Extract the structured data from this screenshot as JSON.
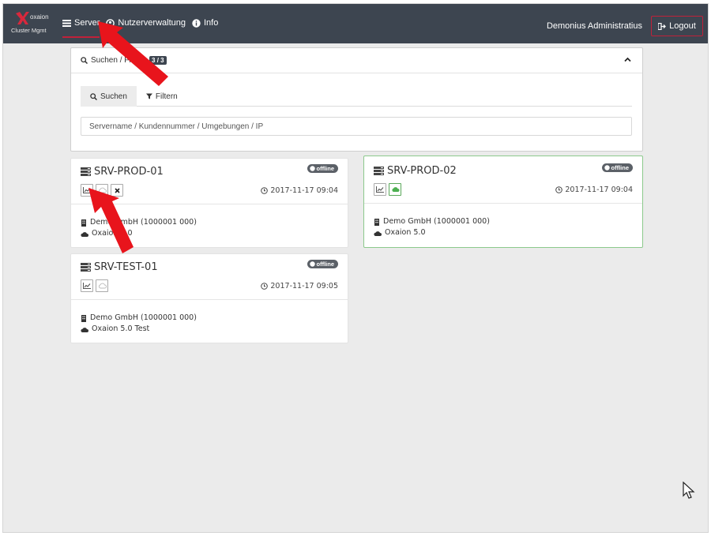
{
  "app": {
    "brand": "oxaion",
    "subtitle": "Cluster Mgmt",
    "accent_color": "#c0213a",
    "navbar_color": "#3d4550"
  },
  "nav": {
    "items": [
      {
        "label": "Server",
        "icon": "server-icon",
        "active": true
      },
      {
        "label": "Nutzerverwaltung",
        "icon": "user-circle-icon",
        "active": false
      },
      {
        "label": "Info",
        "icon": "info-icon",
        "active": false
      }
    ],
    "user_name": "Demonius Administratius",
    "logout_label": "Logout"
  },
  "search": {
    "title": "Suchen / Filtern",
    "count": "3 / 3",
    "tabs": [
      {
        "label": "Suchen",
        "icon": "search-icon",
        "active": true
      },
      {
        "label": "Filtern",
        "icon": "filter-icon",
        "active": false
      }
    ],
    "placeholder": "Servername / Kundennummer / Umgebungen / IP",
    "value": ""
  },
  "servers": [
    {
      "name": "SRV-PROD-01",
      "status": "offline",
      "timestamp": "2017-11-17 09:04",
      "customer": "Demo GmbH (1000001 000)",
      "environment": "Oxaion 5.0",
      "actions": [
        "chart-icon",
        "cloud-off-icon",
        "close-icon"
      ],
      "selected": false
    },
    {
      "name": "SRV-PROD-02",
      "status": "offline",
      "timestamp": "2017-11-17 09:04",
      "customer": "Demo GmbH (1000001 000)",
      "environment": "Oxaion 5.0",
      "actions": [
        "chart-icon",
        "cloud-upload-icon"
      ],
      "selected": true
    },
    {
      "name": "SRV-TEST-01",
      "status": "offline",
      "timestamp": "2017-11-17 09:05",
      "customer": "Demo GmbH (1000001 000)",
      "environment": "Oxaion 5.0 Test",
      "actions": [
        "chart-icon",
        "cloud-off-icon"
      ],
      "selected": false
    }
  ]
}
